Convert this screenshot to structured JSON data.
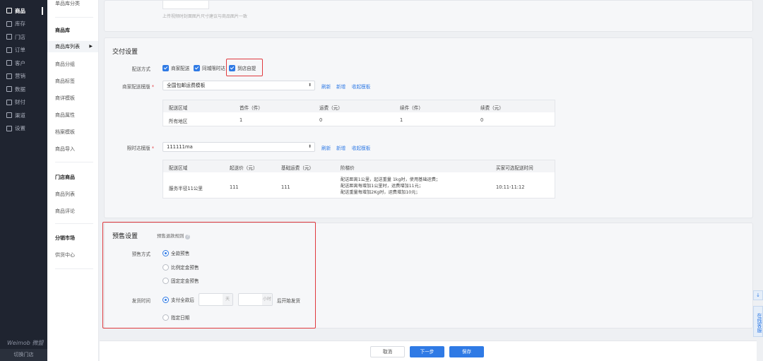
{
  "nav1": {
    "items": [
      {
        "label": "商品",
        "icon": "product-icon",
        "active": true
      },
      {
        "label": "库存",
        "icon": "stock-icon"
      },
      {
        "label": "门店",
        "icon": "store-icon"
      },
      {
        "label": "订单",
        "icon": "order-icon"
      },
      {
        "label": "客户",
        "icon": "customer-icon"
      },
      {
        "label": "营销",
        "icon": "marketing-icon"
      },
      {
        "label": "数据",
        "icon": "data-icon"
      },
      {
        "label": "财付",
        "icon": "finance-icon"
      },
      {
        "label": "渠道",
        "icon": "channel-icon"
      },
      {
        "label": "设置",
        "icon": "settings-icon"
      }
    ],
    "logo": "Weimob 微盟",
    "switch_store": "切换门店"
  },
  "nav2": {
    "top_item": "单品库分类",
    "group1": "商品库",
    "selected": "商品库列表",
    "items1": [
      "商品分组",
      "商品标签",
      "商详模板",
      "商品属性",
      "档案模板",
      "商品导入"
    ],
    "group2": "门店商品",
    "items2": [
      "商品列表",
      "商品评论"
    ],
    "group3": "分销市场",
    "items3": [
      "供货中心"
    ]
  },
  "top_hint": "上传视频时封面图片尺寸建议与商品图片一致",
  "delivery": {
    "title": "交付设置",
    "method_label": "配送方式",
    "methods": [
      "商家配送",
      "同城限时达",
      "到店自提"
    ],
    "merchant_template_label": "商家配送模版",
    "merchant_template_value": "全国包邮运费模板",
    "links": [
      "刷新",
      "新增",
      "收起模板"
    ],
    "merchant_table": {
      "headers": [
        "配送区域",
        "首件（件）",
        "运费（元）",
        "续件（件）",
        "续费（元）"
      ],
      "row": [
        "所有地区",
        "1",
        "0",
        "1",
        "0"
      ]
    },
    "city_template_label": "限时达模版",
    "city_template_value": "111111ma",
    "city_table": {
      "headers": [
        "配送区域",
        "起送价（元）",
        "基础运费（元）",
        "阶梯价",
        "买家可选配送时间"
      ],
      "row": [
        "服务半径11公里",
        "111",
        "111"
      ],
      "ladder": [
        "配送距离1公里，起送重量 1kg时，使用基础运费；",
        "配送距离每增加1公里时，运费增加11元；",
        "配送重量每增加2Kg时，运费增加10元；"
      ],
      "time": "10:11-11:12"
    }
  },
  "presale": {
    "title": "预售设置",
    "rule_link": "预售退款规则",
    "method_label": "预售方式",
    "methods": [
      "全款预售",
      "比例定金预售",
      "固定定金预售"
    ],
    "ship_label": "发货时间",
    "ship_option1": "支付全款后",
    "day_unit": "天",
    "hour_unit": "小时",
    "ship_suffix": "后开始发货",
    "ship_option2": "指定日期"
  },
  "footer": {
    "cancel": "取消",
    "next": "下一步",
    "save": "保存"
  },
  "side": {
    "download": "↓",
    "service": "在线客服"
  }
}
